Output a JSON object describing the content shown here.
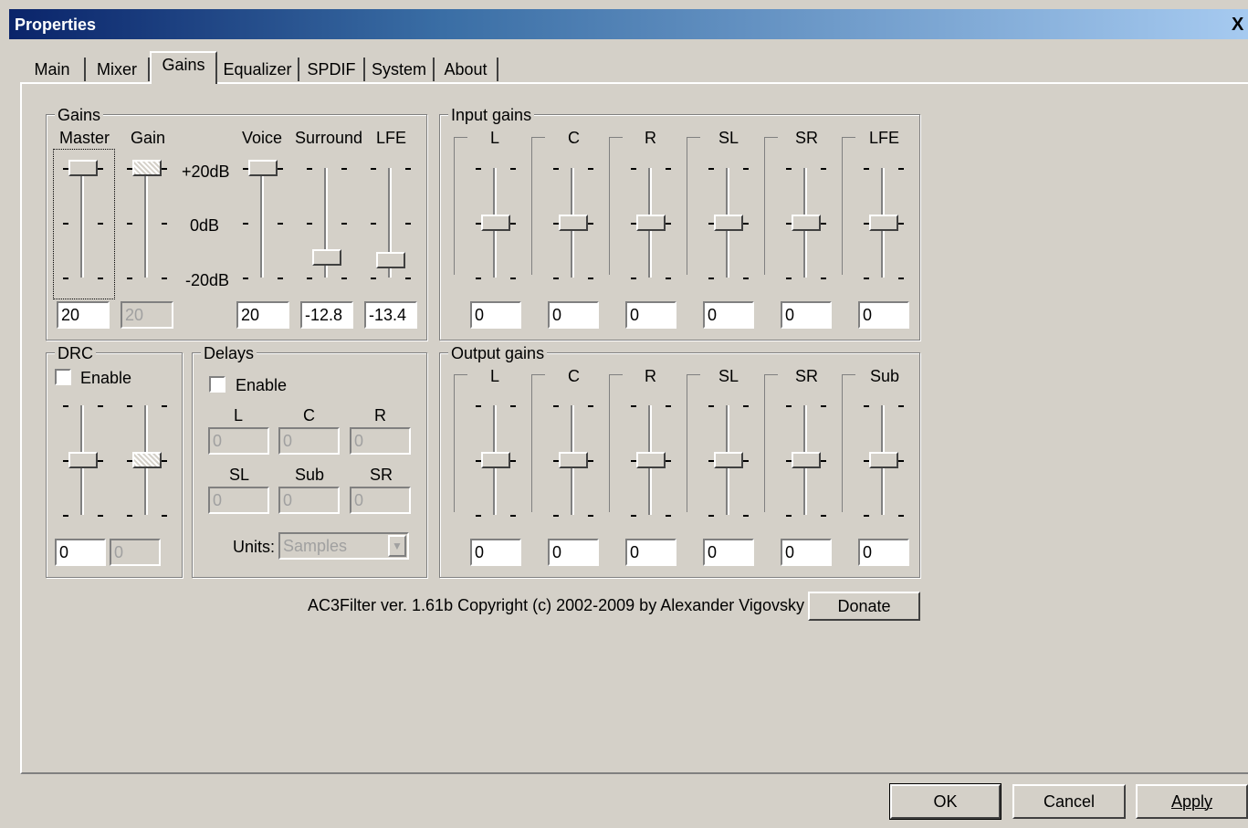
{
  "window": {
    "title": "Properties",
    "close_glyph": "X"
  },
  "tabs": [
    "Main",
    "Mixer",
    "Gains",
    "Equalizer",
    "SPDIF",
    "System",
    "About"
  ],
  "active_tab": "Gains",
  "gains": {
    "group_label": "Gains",
    "master_label": "Master",
    "gain_label": "Gain",
    "voice_label": "Voice",
    "surround_label": "Surround",
    "lfe_label": "LFE",
    "scale_top": "+20dB",
    "scale_mid": "0dB",
    "scale_bottom": "-20dB",
    "master_value": "20",
    "gain_value": "20",
    "voice_value": "20",
    "surround_value": "-12.8",
    "lfe_value": "-13.4"
  },
  "input_gains": {
    "group_label": "Input gains",
    "channels": [
      "L",
      "C",
      "R",
      "SL",
      "SR",
      "LFE"
    ],
    "values": [
      "0",
      "0",
      "0",
      "0",
      "0",
      "0"
    ]
  },
  "output_gains": {
    "group_label": "Output gains",
    "channels": [
      "L",
      "C",
      "R",
      "SL",
      "SR",
      "Sub"
    ],
    "values": [
      "0",
      "0",
      "0",
      "0",
      "0",
      "0"
    ]
  },
  "drc": {
    "group_label": "DRC",
    "enable_label": "Enable",
    "value1": "0",
    "value2": "0"
  },
  "delays": {
    "group_label": "Delays",
    "enable_label": "Enable",
    "ch_L": "L",
    "ch_C": "C",
    "ch_R": "R",
    "ch_SL": "SL",
    "ch_Sub": "Sub",
    "ch_SR": "SR",
    "val_L": "0",
    "val_C": "0",
    "val_R": "0",
    "val_SL": "0",
    "val_Sub": "0",
    "val_SR": "0",
    "units_label": "Units:",
    "units_value": "Samples"
  },
  "footer": {
    "copyright": "AC3Filter ver. 1.61b Copyright (c) 2002-2009 by Alexander Vigovsky",
    "donate_label": "Donate"
  },
  "buttons": {
    "ok": "OK",
    "cancel": "Cancel",
    "apply": "Apply"
  }
}
